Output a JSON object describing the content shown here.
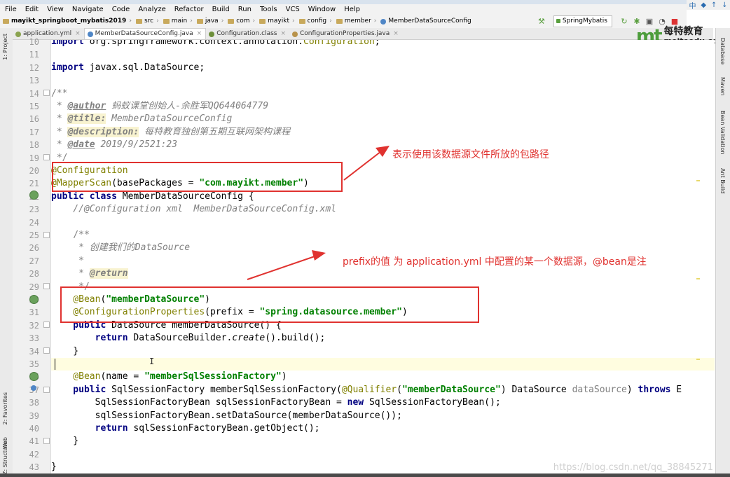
{
  "menu": [
    "File",
    "Edit",
    "View",
    "Navigate",
    "Code",
    "Analyze",
    "Refactor",
    "Build",
    "Run",
    "Tools",
    "VCS",
    "Window",
    "Help"
  ],
  "breadcrumbs": [
    "mayikt_springboot_mybatis2019",
    "src",
    "main",
    "java",
    "com",
    "mayikt",
    "config",
    "member",
    "MemberDataSourceConfig"
  ],
  "run_config": "SpringMybatis",
  "window_controls": [
    "中",
    "◆",
    "↑",
    "↓"
  ],
  "tabs": [
    {
      "label": "application.yml",
      "active": false,
      "color": "#8aa34f"
    },
    {
      "label": "MemberDataSourceConfig.java",
      "active": true,
      "color": "#4f86c6"
    },
    {
      "label": "Configuration.class",
      "active": false,
      "color": "#6d8f3a"
    },
    {
      "label": "ConfigurationProperties.java",
      "active": false,
      "color": "#b8924a"
    }
  ],
  "left_tools": [
    "1: Project",
    "2: Favorites",
    "Web",
    "Z: Structure"
  ],
  "right_tools": [
    "Database",
    "Maven",
    "Bean Validation",
    "Ant Build"
  ],
  "logo": {
    "mark": "mt",
    "name": "每特教育",
    "url": "meiteedu.com"
  },
  "line_numbers": [
    "10",
    "11",
    "12",
    "13",
    "14",
    "15",
    "16",
    "17",
    "18",
    "19",
    "20",
    "21",
    "22",
    "23",
    "24",
    "25",
    "26",
    "27",
    "28",
    "29",
    "30",
    "31",
    "32",
    "33",
    "34",
    "35",
    "36",
    "37",
    "38",
    "39",
    "40",
    "41",
    "42",
    "43"
  ],
  "code": {
    "l10": {
      "kw": "import",
      "rest": " org.springframework.context.annotation.",
      "ann": "Configuration",
      ";": ";"
    },
    "l12": {
      "kw": "import",
      "rest": " javax.sql.DataSource;"
    },
    "l14": "/**",
    "l15": {
      "pre": " * ",
      "tag": "@author",
      "text": " 蚂蚁课堂创始人-余胜军QQ644064779"
    },
    "l16": {
      "pre": " * ",
      "tag": "@title:",
      "text": " MemberDataSourceConfig"
    },
    "l17": {
      "pre": " * ",
      "tag": "@description:",
      "text": " 每特教育独创第五期互联网架构课程"
    },
    "l18": {
      "pre": " * ",
      "tag": "@date",
      "text": " 2019/9/2521:23"
    },
    "l19": " */",
    "l20": "@Configuration",
    "l21": {
      "ann": "@MapperScan",
      "open": "(basePackages = ",
      "str": "\"com.mayikt.member\"",
      "close": ")"
    },
    "l22": {
      "kw": "public class",
      "rest": " MemberDataSourceConfig {"
    },
    "l23": "    //@Configuration xml  MemberDataSourceConfig.xml",
    "l25": "    /**",
    "l26": "     * 创建我们的DataSource",
    "l27": "     *",
    "l28": {
      "pre": "     * ",
      "tag": "@return"
    },
    "l29": "     */",
    "l30": {
      "ann": "    @Bean",
      "open": "(",
      "str": "\"memberDataSource\"",
      "close": ")"
    },
    "l31": {
      "ann": "    @ConfigurationProperties",
      "open": "(prefix = ",
      "str": "\"spring.datasource.member\"",
      "close": ")"
    },
    "l32": {
      "kw": "    public",
      "rest": " DataSource memberDataSource() {"
    },
    "l33": {
      "kw": "        return",
      "rest": " DataSourceBuilder.",
      "it": "create",
      "tail": "().build();"
    },
    "l34": "    }",
    "l36": {
      "ann": "    @Bean",
      "open": "(name = ",
      "str": "\"memberSqlSessionFactory\"",
      "close": ")"
    },
    "l37": {
      "kw": "    public",
      "rest": " SqlSessionFactory memberSqlSessionFactory(",
      "ann": "@Qualifier",
      "open": "(",
      "str": "\"memberDataSource\"",
      "close": ") DataSource ",
      "param": "dataSource",
      "close2": ") ",
      "kw2": "throws",
      "tail": " E"
    },
    "l38": {
      "pre": "        SqlSessionFactoryBean sqlSessionFactoryBean = ",
      "kw": "new",
      "rest": " SqlSessionFactoryBean();"
    },
    "l39": "        sqlSessionFactoryBean.setDataSource(memberDataSource());",
    "l40": {
      "kw": "        return",
      "rest": " sqlSessionFactoryBean.getObject();"
    },
    "l41": "    }",
    "l43": "}"
  },
  "annotations": {
    "callout1": "表示使用该数据源文件所放的包路径",
    "callout2": "prefix的值 为 application.yml 中配置的某一个数据源，@bean是注"
  },
  "watermark": "https://blog.csdn.net/qq_38845271",
  "colors": {
    "annotation_red": "#e0322f",
    "keyword": "#000080",
    "string": "#008000",
    "annotation": "#808000",
    "comment": "#808080",
    "logo_green": "#4d9d3c"
  }
}
